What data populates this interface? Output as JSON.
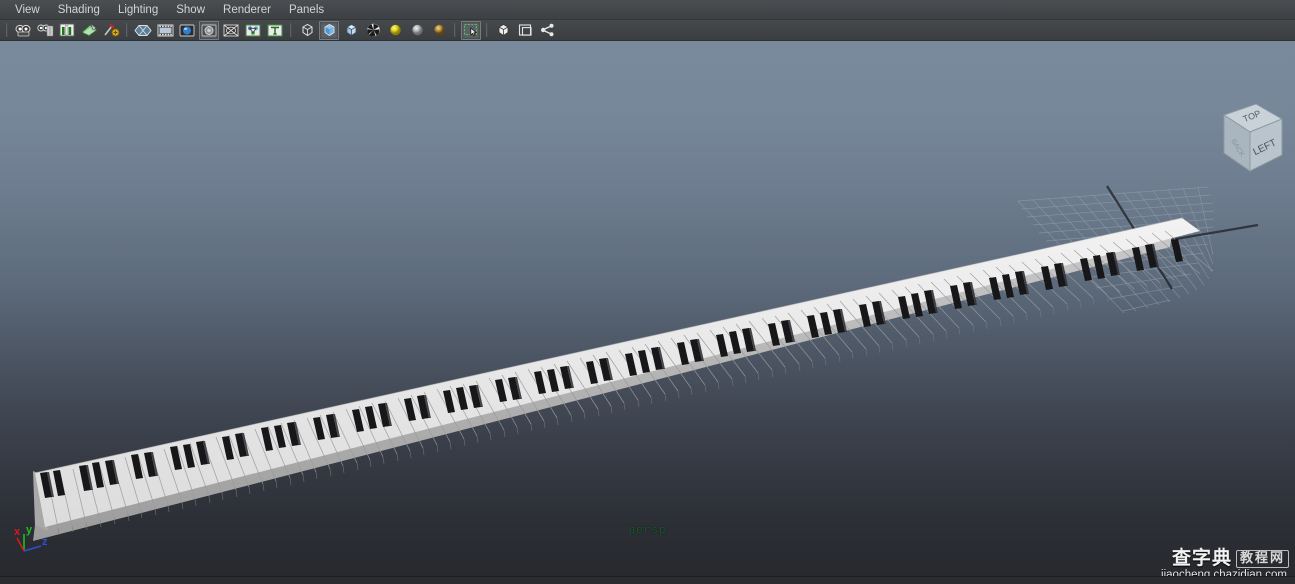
{
  "app": {
    "name": "Autodesk Maya viewport panel",
    "camera_label": "persp"
  },
  "menubar": {
    "items": [
      {
        "label": "View",
        "name": "menu-view"
      },
      {
        "label": "Shading",
        "name": "menu-shading"
      },
      {
        "label": "Lighting",
        "name": "menu-lighting"
      },
      {
        "label": "Show",
        "name": "menu-show"
      },
      {
        "label": "Renderer",
        "name": "menu-renderer"
      },
      {
        "label": "Panels",
        "name": "menu-panels"
      }
    ]
  },
  "toolbar": {
    "groups": [
      {
        "items": [
          {
            "icon": "camera-icon",
            "title": "Select camera"
          },
          {
            "icon": "camera-attributes-icon",
            "title": "Camera attributes"
          },
          {
            "icon": "bookmark-icon",
            "title": "Bookmarks"
          },
          {
            "icon": "image-plane-icon",
            "title": "Image plane"
          },
          {
            "icon": "two-d-pan-zoom-icon",
            "title": "2D Pan / Zoom"
          }
        ]
      },
      {
        "items": [
          {
            "icon": "grid-display-icon",
            "title": "Grid display toggle"
          },
          {
            "icon": "film-gate-icon",
            "title": "Film gate"
          },
          {
            "icon": "resolution-gate-icon",
            "title": "Resolution gate"
          },
          {
            "icon": "gate-mask-icon",
            "title": "Gate mask",
            "state": "active"
          },
          {
            "icon": "xray-icon",
            "title": "X-ray display"
          },
          {
            "icon": "joints-xray-icon",
            "title": "X-ray joints"
          },
          {
            "icon": "text-display-icon",
            "title": "Display text / HUD"
          }
        ]
      },
      {
        "items": [
          {
            "icon": "wireframe-icon",
            "title": "Wireframe shading"
          },
          {
            "icon": "smooth-shade-icon",
            "title": "Smooth shade all",
            "state": "active"
          },
          {
            "icon": "shaded-wireframe-icon",
            "title": "Shaded + wireframe"
          },
          {
            "icon": "textured-icon",
            "title": "Hardware texturing"
          },
          {
            "icon": "use-default-light-icon",
            "title": "Use default light"
          },
          {
            "icon": "use-all-lights-icon",
            "title": "Use all lights"
          },
          {
            "icon": "shadows-icon",
            "title": "Shadows"
          }
        ]
      },
      {
        "items": [
          {
            "icon": "marquee-select-icon",
            "title": "Isolate select",
            "state": "active"
          }
        ]
      },
      {
        "items": [
          {
            "icon": "xray-cube-icon",
            "title": "X-ray mode"
          },
          {
            "icon": "panel-layout-icon",
            "title": "Panel layout"
          },
          {
            "icon": "share-graph-icon",
            "title": "Hypergraph / connections"
          }
        ]
      }
    ]
  },
  "viewcube": {
    "face_top": "TOP",
    "face_front": "LEFT",
    "face_side": "BACK"
  },
  "axis_gizmo": {
    "labels": [
      "x",
      "y",
      "z"
    ],
    "colors": {
      "x": "#d81a1a",
      "y": "#19c219",
      "z": "#2a4fd8"
    }
  },
  "scene": {
    "object": "piano-keyboard",
    "keys": {
      "white_count": 88,
      "white_color": "#e9e9e9",
      "black_color": "#1b1b1e"
    },
    "grid": {
      "visible": true,
      "line_color": "#8e9aa6",
      "axis_color": "#1a1c20"
    }
  },
  "colors": {
    "menubar_bg": "#434749",
    "toolbar_bg": "#414447",
    "viewport_top": "#7a8a9d",
    "viewport_bottom": "#26282c",
    "camera_label": "#1f5c2c"
  },
  "watermark": {
    "brand": "查字典",
    "boxed": "教程网",
    "url": "jiaocheng.chazidian.com"
  }
}
